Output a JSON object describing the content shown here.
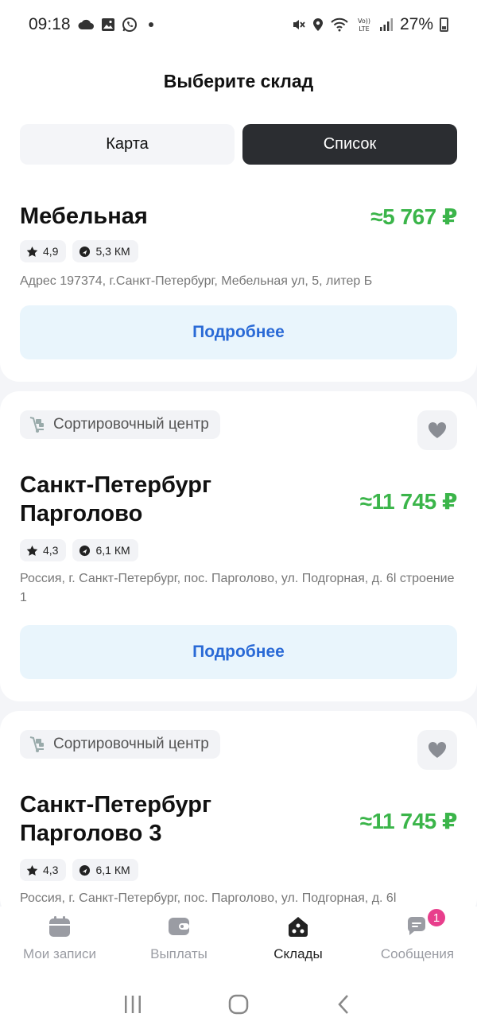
{
  "status_bar": {
    "time": "09:18",
    "battery": "27%"
  },
  "header": {
    "title": "Выберите склад"
  },
  "view_toggle": {
    "map_label": "Карта",
    "list_label": "Список",
    "selected": "list"
  },
  "warehouses": [
    {
      "name": "Мебельная",
      "price": "≈5 767 ₽",
      "rating": "4,9",
      "distance": "5,3 КМ",
      "address": "Адрес 197374, г.Санкт-Петербург, Мебельная ул, 5, литер Б",
      "details_label": "Подробнее"
    },
    {
      "type_label": "Сортировочный центр",
      "name_line1": "Санкт-Петербург",
      "name_line2": "Парголово",
      "price": "≈11 745 ₽",
      "rating": "4,3",
      "distance": "6,1 КМ",
      "address": "Россия, г. Санкт-Петербург, пос. Парголово, ул. Подгорная, д. 6l строение 1",
      "details_label": "Подробнее"
    },
    {
      "type_label": "Сортировочный центр",
      "name_line1": "Санкт-Петербург",
      "name_line2": "Парголово 3",
      "price": "≈11 745 ₽",
      "rating": "4,3",
      "distance": "6,1 КМ",
      "address": "Россия, г. Санкт-Петербург, пос. Парголово, ул. Подгорная, д. 6l"
    }
  ],
  "bottom_nav": {
    "items": [
      {
        "label": "Мои записи",
        "icon": "calendar-icon"
      },
      {
        "label": "Выплаты",
        "icon": "wallet-icon"
      },
      {
        "label": "Склады",
        "icon": "warehouse-icon",
        "active": true
      },
      {
        "label": "Сообщения",
        "icon": "chat-icon",
        "badge": "1"
      }
    ]
  },
  "colors": {
    "accent_green": "#3bb54a",
    "link_blue": "#2a6ad6",
    "dark_toggle": "#2b2d31",
    "badge_pink": "#e83e8c"
  }
}
